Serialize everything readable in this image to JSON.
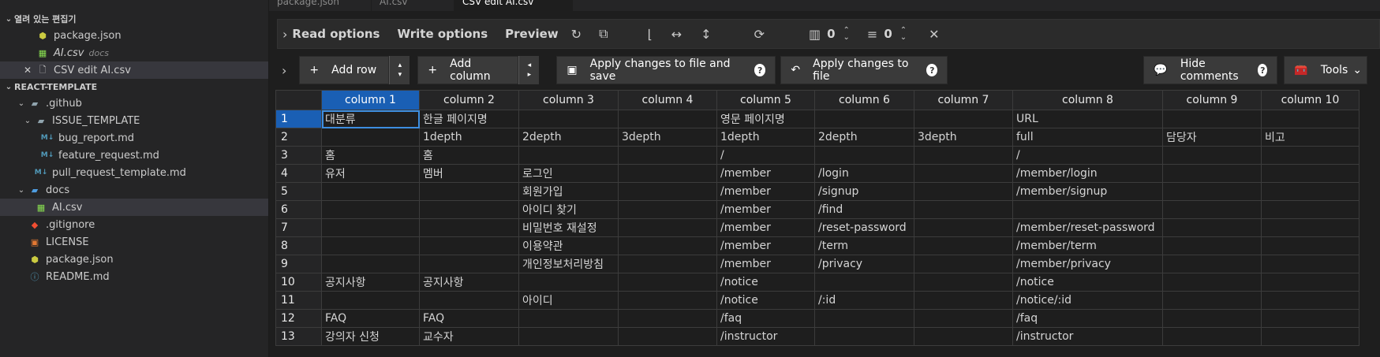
{
  "sidebar": {
    "open_editors_header": "열려 있는 편집기",
    "open_editors": [
      {
        "name": "package.json",
        "desc": "",
        "icon": "json-icon"
      },
      {
        "name": "AI.csv",
        "desc": "docs",
        "icon": "csv-icon"
      },
      {
        "name": "CSV edit AI.csv",
        "desc": "",
        "icon": "file-icon"
      }
    ],
    "project_header": "REACT-TEMPLATE",
    "tree": {
      "github": ".github",
      "issue_template": "ISSUE_TEMPLATE",
      "bug_report": "bug_report.md",
      "feature_request": "feature_request.md",
      "pull_request": "pull_request_template.md",
      "docs": "docs",
      "ai_csv": "AI.csv",
      "gitignore": ".gitignore",
      "license": "LICENSE",
      "package": "package.json",
      "readme": "README.md"
    }
  },
  "tabs": [
    "package.json",
    "AI.csv",
    "CSV edit AI.csv"
  ],
  "toolbar": {
    "read_options": "Read options",
    "write_options": "Write options",
    "preview": "Preview",
    "header_rows_value": "0",
    "skip_rows_value": "0"
  },
  "actions": {
    "add_row": "Add row",
    "add_column": "Add column",
    "apply_save": "Apply changes to file and save",
    "apply": "Apply changes to file",
    "hide_comments": "Hide comments",
    "tools": "Tools",
    "help_glyph": "?"
  },
  "grid": {
    "columns": [
      "column 1",
      "column 2",
      "column 3",
      "column 4",
      "column 5",
      "column 6",
      "column 7",
      "column 8",
      "column 9",
      "column 10"
    ],
    "rows": [
      [
        "대분류",
        "한글 페이지명",
        "",
        "",
        "영문 페이지명",
        "",
        "",
        "URL",
        "",
        ""
      ],
      [
        "",
        "1depth",
        "2depth",
        "3depth",
        "1depth",
        "2depth",
        "3depth",
        "full",
        "담당자",
        "비고"
      ],
      [
        "홈",
        "홈",
        "",
        "",
        "/",
        "",
        "",
        "/",
        "",
        ""
      ],
      [
        "유저",
        "멤버",
        "로그인",
        "",
        "/member",
        "/login",
        "",
        "/member/login",
        "",
        ""
      ],
      [
        "",
        "",
        "회원가입",
        "",
        "/member",
        "/signup",
        "",
        "/member/signup",
        "",
        ""
      ],
      [
        "",
        "",
        "아이디 찾기",
        "",
        "/member",
        "/find",
        "",
        "",
        "",
        ""
      ],
      [
        "",
        "",
        "비밀번호 재설정",
        "",
        "/member",
        "/reset-password",
        "",
        "/member/reset-password",
        "",
        ""
      ],
      [
        "",
        "",
        "이용약관",
        "",
        "/member",
        "/term",
        "",
        "/member/term",
        "",
        ""
      ],
      [
        "",
        "",
        "개인정보처리방침",
        "",
        "/member",
        "/privacy",
        "",
        "/member/privacy",
        "",
        ""
      ],
      [
        "공지사항",
        "공지사항",
        "",
        "",
        "/notice",
        "",
        "",
        "/notice",
        "",
        ""
      ],
      [
        "",
        "",
        "아이디",
        "",
        "/notice",
        "/:id",
        "",
        "/notice/:id",
        "",
        ""
      ],
      [
        "FAQ",
        "FAQ",
        "",
        "",
        "/faq",
        "",
        "",
        "/faq",
        "",
        ""
      ],
      [
        "강의자 신청",
        "교수자",
        "",
        "",
        "/instructor",
        "",
        "",
        "/instructor",
        "",
        ""
      ]
    ]
  }
}
